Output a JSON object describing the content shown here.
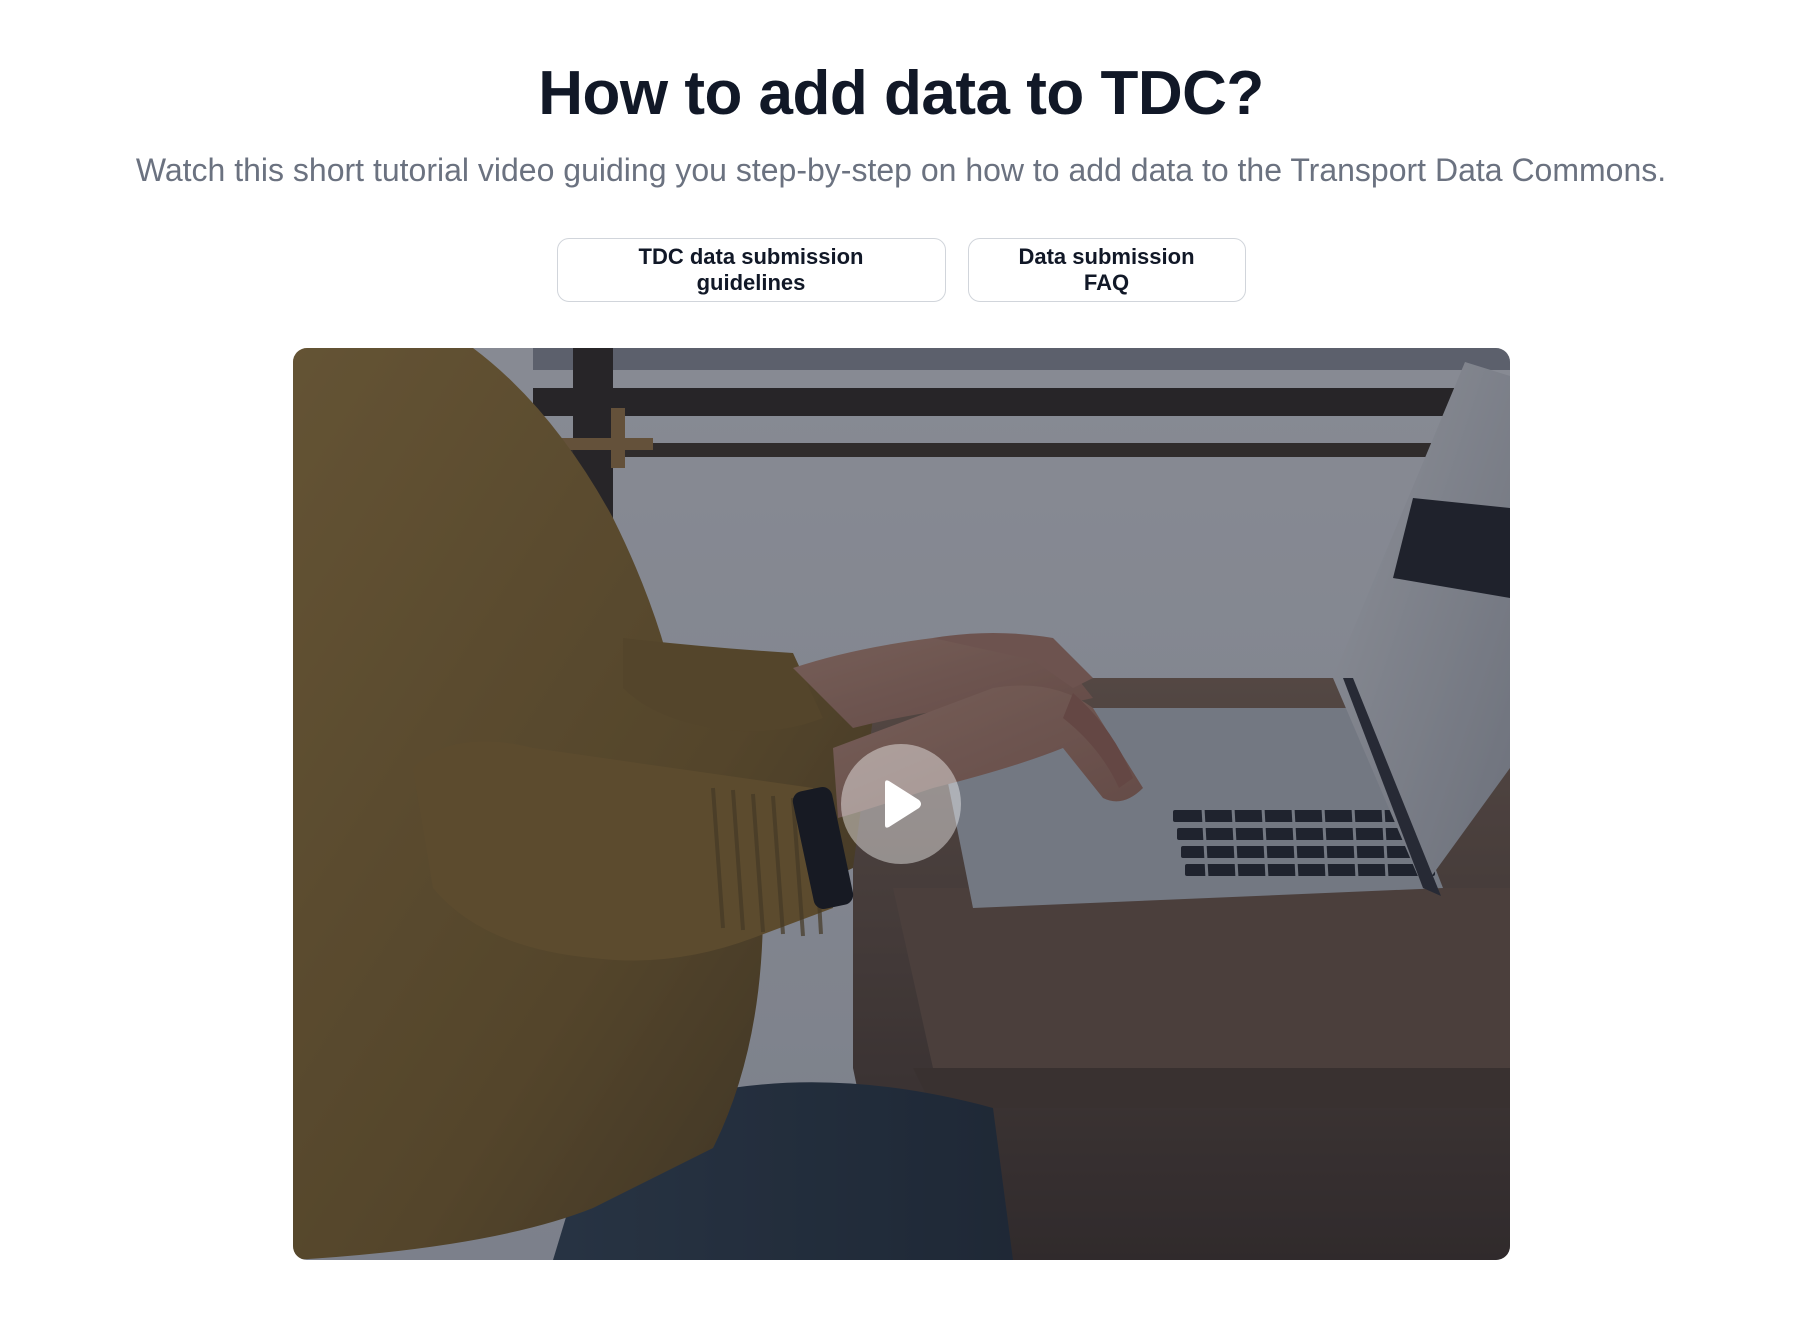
{
  "header": {
    "title": "How to add data to TDC?",
    "subtitle": "Watch this short tutorial video guiding you step-by-step on how to add data to the Transport Data Commons."
  },
  "actions": {
    "guidelines_label": "TDC data submission guidelines",
    "faq_label": "Data submission FAQ"
  },
  "video": {
    "thumbnail_description_icon": "laptop-typing-thumbnail",
    "play_icon": "play-icon"
  },
  "colors": {
    "title": "#111827",
    "subtitle": "#6b7280",
    "button_border": "#d1d5db",
    "overlay": "#111827"
  }
}
